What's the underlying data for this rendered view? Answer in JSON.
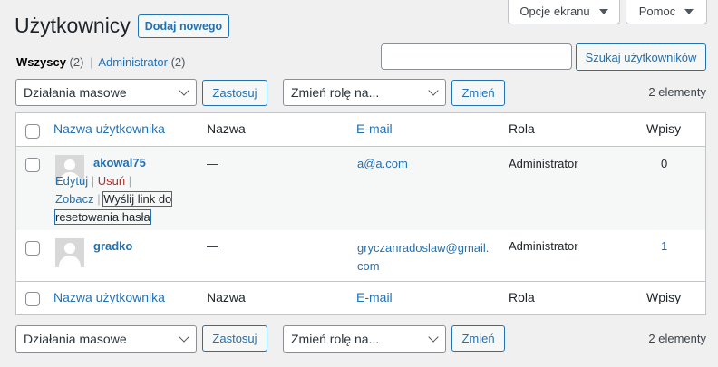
{
  "screen_tabs": {
    "screen_options": "Opcje ekranu",
    "help": "Pomoc"
  },
  "page": {
    "title": "Użytkownicy",
    "add_new": "Dodaj nowego"
  },
  "filters": {
    "all_label": "Wszyscy",
    "all_count": "(2)",
    "separator": "|",
    "admin_label": "Administrator",
    "admin_count": "(2)"
  },
  "search": {
    "value": "",
    "button": "Szukaj użytkowników"
  },
  "bulk_top": {
    "bulk_select": "Działania masowe",
    "apply": "Zastosuj",
    "role_select": "Zmień rolę na...",
    "change": "Zmień",
    "count": "2 elementy"
  },
  "bulk_bottom": {
    "bulk_select": "Działania masowe",
    "apply": "Zastosuj",
    "role_select": "Zmień rolę na...",
    "change": "Zmień",
    "count": "2 elementy"
  },
  "table": {
    "columns": [
      "Nazwa użytkownika",
      "Nazwa",
      "E-mail",
      "Rola",
      "Wpisy"
    ],
    "rows": [
      {
        "username": "akowal75",
        "name": "—",
        "email": "a@a.com",
        "role": "Administrator",
        "posts": "0",
        "actions": {
          "edit": "Edytuj",
          "delete": "Usuń",
          "view": "Zobacz",
          "reset_line1": "Wyślij link do",
          "reset_line2": "resetowania hasła"
        }
      },
      {
        "username": "gradko",
        "name": "—",
        "email_line1": "gryczanradoslaw@gmail.",
        "email_line2": "com",
        "role": "Administrator",
        "posts": "1"
      }
    ]
  }
}
